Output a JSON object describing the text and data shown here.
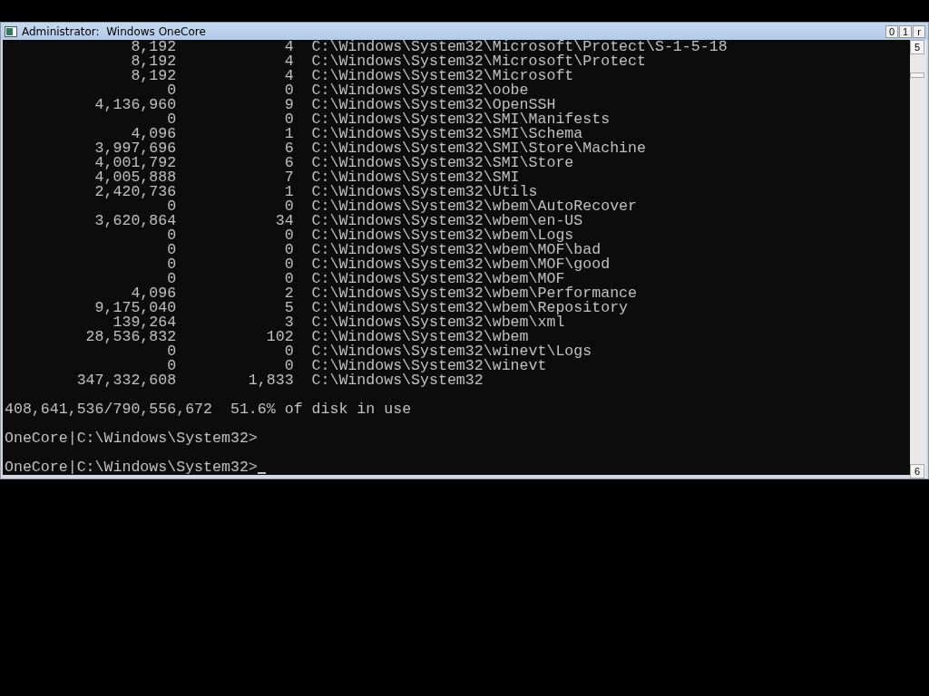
{
  "window": {
    "title": "Administrator:  Windows OneCore",
    "title_buttons": [
      "0",
      "1",
      "r"
    ]
  },
  "listing": [
    {
      "size": "8,192",
      "count": "4",
      "path": "C:\\Windows\\System32\\Microsoft\\Protect\\S-1-5-18"
    },
    {
      "size": "8,192",
      "count": "4",
      "path": "C:\\Windows\\System32\\Microsoft\\Protect"
    },
    {
      "size": "8,192",
      "count": "4",
      "path": "C:\\Windows\\System32\\Microsoft"
    },
    {
      "size": "0",
      "count": "0",
      "path": "C:\\Windows\\System32\\oobe"
    },
    {
      "size": "4,136,960",
      "count": "9",
      "path": "C:\\Windows\\System32\\OpenSSH"
    },
    {
      "size": "0",
      "count": "0",
      "path": "C:\\Windows\\System32\\SMI\\Manifests"
    },
    {
      "size": "4,096",
      "count": "1",
      "path": "C:\\Windows\\System32\\SMI\\Schema"
    },
    {
      "size": "3,997,696",
      "count": "6",
      "path": "C:\\Windows\\System32\\SMI\\Store\\Machine"
    },
    {
      "size": "4,001,792",
      "count": "6",
      "path": "C:\\Windows\\System32\\SMI\\Store"
    },
    {
      "size": "4,005,888",
      "count": "7",
      "path": "C:\\Windows\\System32\\SMI"
    },
    {
      "size": "2,420,736",
      "count": "1",
      "path": "C:\\Windows\\System32\\Utils"
    },
    {
      "size": "0",
      "count": "0",
      "path": "C:\\Windows\\System32\\wbem\\AutoRecover"
    },
    {
      "size": "3,620,864",
      "count": "34",
      "path": "C:\\Windows\\System32\\wbem\\en-US"
    },
    {
      "size": "0",
      "count": "0",
      "path": "C:\\Windows\\System32\\wbem\\Logs"
    },
    {
      "size": "0",
      "count": "0",
      "path": "C:\\Windows\\System32\\wbem\\MOF\\bad"
    },
    {
      "size": "0",
      "count": "0",
      "path": "C:\\Windows\\System32\\wbem\\MOF\\good"
    },
    {
      "size": "0",
      "count": "0",
      "path": "C:\\Windows\\System32\\wbem\\MOF"
    },
    {
      "size": "4,096",
      "count": "2",
      "path": "C:\\Windows\\System32\\wbem\\Performance"
    },
    {
      "size": "9,175,040",
      "count": "5",
      "path": "C:\\Windows\\System32\\wbem\\Repository"
    },
    {
      "size": "139,264",
      "count": "3",
      "path": "C:\\Windows\\System32\\wbem\\xml"
    },
    {
      "size": "28,536,832",
      "count": "102",
      "path": "C:\\Windows\\System32\\wbem"
    },
    {
      "size": "0",
      "count": "0",
      "path": "C:\\Windows\\System32\\winevt\\Logs"
    },
    {
      "size": "0",
      "count": "0",
      "path": "C:\\Windows\\System32\\winevt"
    },
    {
      "size": "347,332,608",
      "count": "1,833",
      "path": "C:\\Windows\\System32"
    }
  ],
  "summary": "408,641,536/790,556,672  51.6% of disk in use",
  "prompts": [
    "OneCore|C:\\Windows\\System32>",
    "OneCore|C:\\Windows\\System32>"
  ],
  "scrollbar": {
    "up": "5",
    "down": "6"
  }
}
